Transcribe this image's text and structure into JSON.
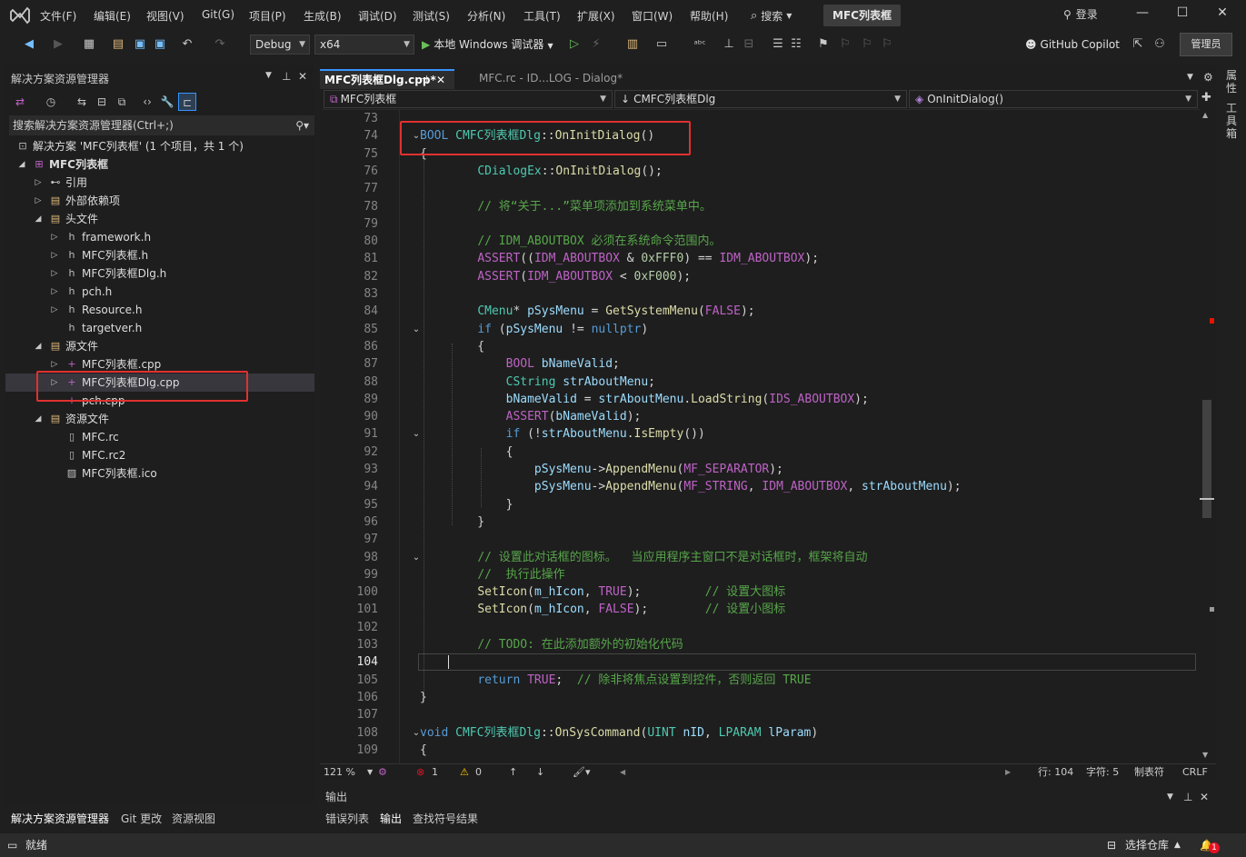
{
  "menubar": {
    "items": [
      "文件(F)",
      "编辑(E)",
      "视图(V)",
      "Git(G)",
      "项目(P)",
      "生成(B)",
      "调试(D)",
      "测试(S)",
      "分析(N)",
      "工具(T)",
      "扩展(X)",
      "窗口(W)",
      "帮助(H)"
    ],
    "search_label": "搜索",
    "project_name": "MFC列表框",
    "login_label": "登录"
  },
  "toolbar": {
    "config": "Debug",
    "platform": "x64",
    "run_label": "本地 Windows 调试器",
    "copilot_label": "GitHub Copilot",
    "admin_label": "管理员"
  },
  "solution_explorer": {
    "title": "解决方案资源管理器",
    "search_placeholder": "搜索解决方案资源管理器(Ctrl+;)",
    "items": [
      {
        "label": "解决方案 'MFC列表框' (1 个项目，共 1 个)",
        "level": 0,
        "arrow": "",
        "icon": "solution-icon"
      },
      {
        "label": "MFC列表框",
        "level": 1,
        "arrow": "down",
        "icon": "project-icon",
        "bold": true
      },
      {
        "label": "引用",
        "level": 2,
        "arrow": "right",
        "icon": "references-icon"
      },
      {
        "label": "外部依赖项",
        "level": 2,
        "arrow": "right",
        "icon": "folder-icon"
      },
      {
        "label": "头文件",
        "level": 2,
        "arrow": "down",
        "icon": "folder-icon"
      },
      {
        "label": "framework.h",
        "level": 3,
        "arrow": "right",
        "icon": "header-file-icon"
      },
      {
        "label": "MFC列表框.h",
        "level": 3,
        "arrow": "right",
        "icon": "header-file-icon"
      },
      {
        "label": "MFC列表框Dlg.h",
        "level": 3,
        "arrow": "right",
        "icon": "header-file-icon"
      },
      {
        "label": "pch.h",
        "level": 3,
        "arrow": "right",
        "icon": "header-file-icon"
      },
      {
        "label": "Resource.h",
        "level": 3,
        "arrow": "right",
        "icon": "header-file-icon"
      },
      {
        "label": "targetver.h",
        "level": 3,
        "arrow": "",
        "icon": "header-file-icon"
      },
      {
        "label": "源文件",
        "level": 2,
        "arrow": "down",
        "icon": "folder-icon"
      },
      {
        "label": "MFC列表框.cpp",
        "level": 3,
        "arrow": "right",
        "icon": "cpp-file-icon"
      },
      {
        "label": "MFC列表框Dlg.cpp",
        "level": 3,
        "arrow": "right",
        "icon": "cpp-file-icon",
        "selected": true
      },
      {
        "label": "pch.cpp",
        "level": 3,
        "arrow": "",
        "icon": "cpp-file-icon"
      },
      {
        "label": "资源文件",
        "level": 2,
        "arrow": "down",
        "icon": "folder-icon"
      },
      {
        "label": "MFC.rc",
        "level": 3,
        "arrow": "",
        "icon": "resource-file-icon"
      },
      {
        "label": "MFC.rc2",
        "level": 3,
        "arrow": "",
        "icon": "resource-file-icon"
      },
      {
        "label": "MFC列表框.ico",
        "level": 3,
        "arrow": "",
        "icon": "image-file-icon"
      }
    ],
    "bottom_tabs": [
      "解决方案资源管理器",
      "Git 更改",
      "资源视图"
    ]
  },
  "editor": {
    "tabs": [
      {
        "label": "MFC列表框Dlg.cpp*",
        "active": true
      },
      {
        "label": "MFC.rc - ID...LOG - Dialog*",
        "active": false
      }
    ],
    "nav": {
      "scope": "MFC列表框",
      "class": "CMFC列表框Dlg",
      "member": "OnInitDialog()"
    },
    "current_line": "104",
    "lines": [
      {
        "n": "73",
        "fold": "",
        "t": []
      },
      {
        "n": "74",
        "fold": "v",
        "t": [
          [
            "kw",
            "BOOL "
          ],
          [
            "ty",
            "CMFC列表框Dlg"
          ],
          [
            "",
            "::"
          ],
          [
            "fn",
            "OnInitDialog"
          ],
          [
            "",
            "()"
          ]
        ]
      },
      {
        "n": "75",
        "fold": "",
        "t": [
          [
            "",
            "{"
          ]
        ]
      },
      {
        "n": "76",
        "fold": "",
        "t": [
          [
            "",
            "    "
          ],
          [
            "ty",
            "CDialogEx"
          ],
          [
            "",
            "::"
          ],
          [
            "fn",
            "OnInitDialog"
          ],
          [
            "",
            "();"
          ]
        ]
      },
      {
        "n": "77",
        "fold": "",
        "t": []
      },
      {
        "n": "78",
        "fold": "",
        "t": [
          [
            "",
            "    "
          ],
          [
            "cm",
            "// 将“关于...”菜单项添加到系统菜单中。"
          ]
        ]
      },
      {
        "n": "79",
        "fold": "",
        "t": []
      },
      {
        "n": "80",
        "fold": "",
        "t": [
          [
            "",
            "    "
          ],
          [
            "cm",
            "// IDM_ABOUTBOX 必须在系统命令范围内。"
          ]
        ]
      },
      {
        "n": "81",
        "fold": "",
        "t": [
          [
            "",
            "    "
          ],
          [
            "mc",
            "ASSERT"
          ],
          [
            "",
            "(("
          ],
          [
            "mc",
            "IDM_ABOUTBOX"
          ],
          [
            "",
            " & "
          ],
          [
            "nm",
            "0xFFF0"
          ],
          [
            "",
            ") == "
          ],
          [
            "mc",
            "IDM_ABOUTBOX"
          ],
          [
            "",
            ");"
          ]
        ]
      },
      {
        "n": "82",
        "fold": "",
        "t": [
          [
            "",
            "    "
          ],
          [
            "mc",
            "ASSERT"
          ],
          [
            "",
            "("
          ],
          [
            "mc",
            "IDM_ABOUTBOX"
          ],
          [
            "",
            " < "
          ],
          [
            "nm",
            "0xF000"
          ],
          [
            "",
            ");"
          ]
        ]
      },
      {
        "n": "83",
        "fold": "",
        "t": []
      },
      {
        "n": "84",
        "fold": "",
        "t": [
          [
            "",
            "    "
          ],
          [
            "ty",
            "CMenu"
          ],
          [
            "",
            "* "
          ],
          [
            "var",
            "pSysMenu"
          ],
          [
            "",
            " = "
          ],
          [
            "fn",
            "GetSystemMenu"
          ],
          [
            "",
            "("
          ],
          [
            "mc",
            "FALSE"
          ],
          [
            "",
            ");"
          ]
        ]
      },
      {
        "n": "85",
        "fold": "v",
        "t": [
          [
            "",
            "    "
          ],
          [
            "kw",
            "if"
          ],
          [
            "",
            " ("
          ],
          [
            "var",
            "pSysMenu"
          ],
          [
            "",
            " != "
          ],
          [
            "kw",
            "nullptr"
          ],
          [
            "",
            ")"
          ]
        ]
      },
      {
        "n": "86",
        "fold": "",
        "t": [
          [
            "",
            "    {"
          ]
        ]
      },
      {
        "n": "87",
        "fold": "",
        "t": [
          [
            "",
            "        "
          ],
          [
            "mc",
            "BOOL"
          ],
          [
            "",
            " "
          ],
          [
            "var",
            "bNameValid"
          ],
          [
            "",
            ";"
          ]
        ]
      },
      {
        "n": "88",
        "fold": "",
        "t": [
          [
            "",
            "        "
          ],
          [
            "ty",
            "CString"
          ],
          [
            "",
            " "
          ],
          [
            "var",
            "strAboutMenu"
          ],
          [
            "",
            ";"
          ]
        ]
      },
      {
        "n": "89",
        "fold": "",
        "t": [
          [
            "",
            "        "
          ],
          [
            "var",
            "bNameValid"
          ],
          [
            "",
            " = "
          ],
          [
            "var",
            "strAboutMenu"
          ],
          [
            "",
            "."
          ],
          [
            "fn",
            "LoadString"
          ],
          [
            "",
            "("
          ],
          [
            "mc",
            "IDS_ABOUTBOX"
          ],
          [
            "",
            ");"
          ]
        ]
      },
      {
        "n": "90",
        "fold": "",
        "t": [
          [
            "",
            "        "
          ],
          [
            "mc",
            "ASSERT"
          ],
          [
            "",
            "("
          ],
          [
            "var",
            "bNameValid"
          ],
          [
            "",
            ");"
          ]
        ]
      },
      {
        "n": "91",
        "fold": "v",
        "t": [
          [
            "",
            "        "
          ],
          [
            "kw",
            "if"
          ],
          [
            "",
            " (!"
          ],
          [
            "var",
            "strAboutMenu"
          ],
          [
            "",
            "."
          ],
          [
            "fn",
            "IsEmpty"
          ],
          [
            "",
            "())"
          ]
        ]
      },
      {
        "n": "92",
        "fold": "",
        "t": [
          [
            "",
            "        {"
          ]
        ]
      },
      {
        "n": "93",
        "fold": "",
        "t": [
          [
            "",
            "            "
          ],
          [
            "var",
            "pSysMenu"
          ],
          [
            "",
            "->"
          ],
          [
            "fn",
            "AppendMenu"
          ],
          [
            "",
            "("
          ],
          [
            "mc",
            "MF_SEPARATOR"
          ],
          [
            "",
            ");"
          ]
        ]
      },
      {
        "n": "94",
        "fold": "",
        "t": [
          [
            "",
            "            "
          ],
          [
            "var",
            "pSysMenu"
          ],
          [
            "",
            "->"
          ],
          [
            "fn",
            "AppendMenu"
          ],
          [
            "",
            "("
          ],
          [
            "mc",
            "MF_STRING"
          ],
          [
            "",
            ", "
          ],
          [
            "mc",
            "IDM_ABOUTBOX"
          ],
          [
            "",
            ", "
          ],
          [
            "var",
            "strAboutMenu"
          ],
          [
            "",
            ");"
          ]
        ]
      },
      {
        "n": "95",
        "fold": "",
        "t": [
          [
            "",
            "        }"
          ]
        ]
      },
      {
        "n": "96",
        "fold": "",
        "t": [
          [
            "",
            "    }"
          ]
        ]
      },
      {
        "n": "97",
        "fold": "",
        "t": []
      },
      {
        "n": "98",
        "fold": "v",
        "t": [
          [
            "",
            "    "
          ],
          [
            "cm",
            "// 设置此对话框的图标。  当应用程序主窗口不是对话框时，框架将自动"
          ]
        ]
      },
      {
        "n": "99",
        "fold": "",
        "t": [
          [
            "",
            "    "
          ],
          [
            "cm",
            "//  执行此操作"
          ]
        ]
      },
      {
        "n": "100",
        "fold": "",
        "t": [
          [
            "",
            "    "
          ],
          [
            "fn",
            "SetIcon"
          ],
          [
            "",
            "("
          ],
          [
            "var",
            "m_hIcon"
          ],
          [
            "",
            ", "
          ],
          [
            "mc",
            "TRUE"
          ],
          [
            "",
            ");         "
          ],
          [
            "cm",
            "// 设置大图标"
          ]
        ]
      },
      {
        "n": "101",
        "fold": "",
        "t": [
          [
            "",
            "    "
          ],
          [
            "fn",
            "SetIcon"
          ],
          [
            "",
            "("
          ],
          [
            "var",
            "m_hIcon"
          ],
          [
            "",
            ", "
          ],
          [
            "mc",
            "FALSE"
          ],
          [
            "",
            ");        "
          ],
          [
            "cm",
            "// 设置小图标"
          ]
        ]
      },
      {
        "n": "102",
        "fold": "",
        "t": []
      },
      {
        "n": "103",
        "fold": "",
        "t": [
          [
            "",
            "    "
          ],
          [
            "cm",
            "// TODO: 在此添加额外的初始化代码"
          ]
        ]
      },
      {
        "n": "104",
        "fold": "",
        "t": [
          [
            "",
            "    "
          ]
        ]
      },
      {
        "n": "105",
        "fold": "",
        "t": [
          [
            "",
            "    "
          ],
          [
            "kw",
            "return"
          ],
          [
            "",
            " "
          ],
          [
            "mc",
            "TRUE"
          ],
          [
            "",
            ";  "
          ],
          [
            "cm",
            "// 除非将焦点设置到控件，否则返回 TRUE"
          ]
        ]
      },
      {
        "n": "106",
        "fold": "",
        "t": [
          [
            "",
            "}"
          ]
        ]
      },
      {
        "n": "107",
        "fold": "",
        "t": []
      },
      {
        "n": "108",
        "fold": "v",
        "t": [
          [
            "kw",
            "void "
          ],
          [
            "ty",
            "CMFC列表框Dlg"
          ],
          [
            "",
            "::"
          ],
          [
            "fn",
            "OnSysCommand"
          ],
          [
            "",
            "("
          ],
          [
            "ty",
            "UINT"
          ],
          [
            "",
            " "
          ],
          [
            "var",
            "nID"
          ],
          [
            "",
            ", "
          ],
          [
            "ty",
            "LPARAM"
          ],
          [
            "",
            " "
          ],
          [
            "var",
            "lParam"
          ],
          [
            "",
            ")"
          ]
        ]
      },
      {
        "n": "109",
        "fold": "",
        "t": [
          [
            "",
            "{"
          ]
        ]
      }
    ]
  },
  "editor_status": {
    "zoom": "121 %",
    "errors": "1",
    "warnings": "0",
    "row": "行: 104",
    "col": "字符: 5",
    "tabs": "制表符",
    "eol": "CRLF"
  },
  "output": {
    "title": "输出",
    "tabs": [
      "错误列表",
      "输出",
      "查找符号结果"
    ]
  },
  "right_side": {
    "tabs": [
      "属性",
      "工具箱"
    ]
  },
  "statusbar": {
    "ready": "就绪",
    "repo": "选择仓库",
    "notifications": "1"
  },
  "colors": {
    "accent": "#569cd6",
    "highlight_box": "#e0312f",
    "error": "#e81123"
  }
}
